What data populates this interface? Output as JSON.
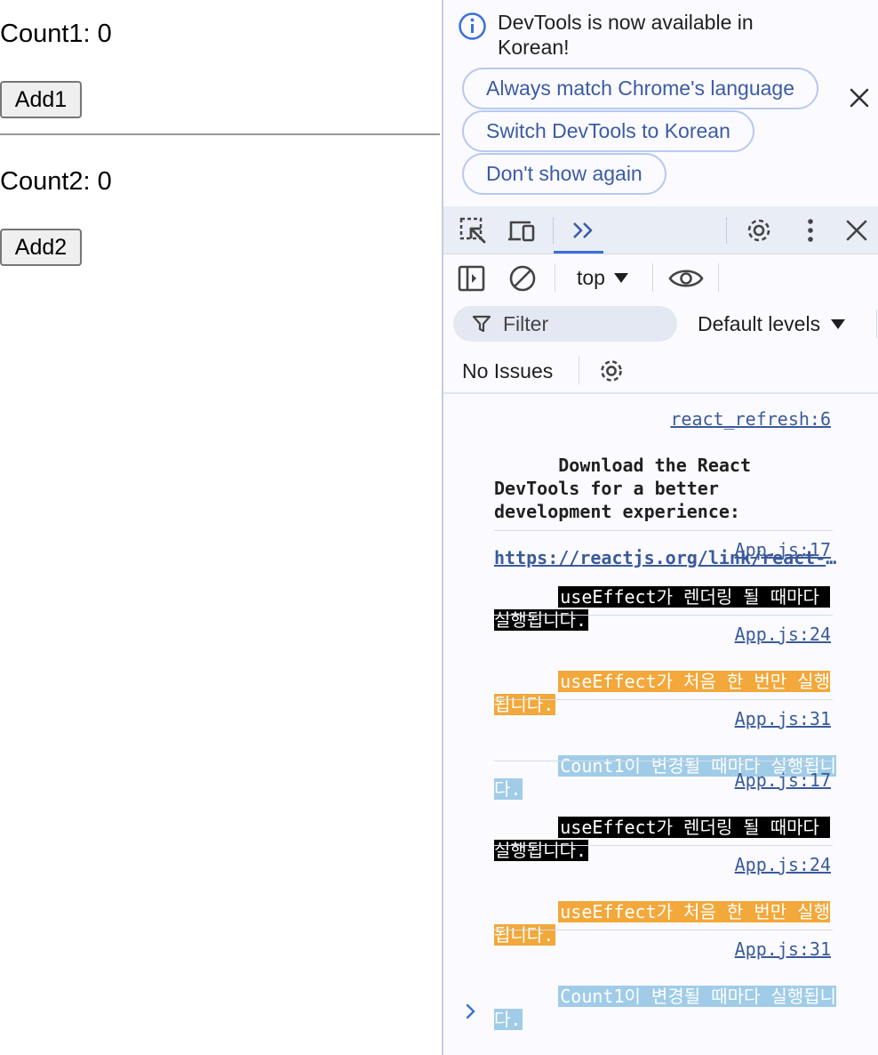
{
  "app": {
    "count1_text": "Count1: 0",
    "add1_label": "Add1",
    "count2_text": "Count2: 0",
    "add2_label": "Add2"
  },
  "devtools": {
    "infobar": {
      "icon": "info-icon",
      "message": "DevTools is now available in Korean!",
      "buttons": [
        {
          "label": "Always match Chrome's language"
        },
        {
          "label": "Switch DevTools to Korean"
        },
        {
          "label": "Don't show again"
        }
      ],
      "close_icon": "close-icon"
    },
    "toolbar": {
      "icons": [
        "inspect-element-icon",
        "device-toolbar-icon",
        "more-tabs-icon",
        "settings-icon",
        "kebab-menu-icon",
        "close-icon"
      ]
    },
    "console_toolbar": {
      "context": "top",
      "icons": [
        "sidebar-toggle-icon",
        "clear-console-icon",
        "eye-icon"
      ]
    },
    "filter": {
      "placeholder": "Filter",
      "levels": "Default levels"
    },
    "issues": {
      "text": "No Issues"
    },
    "log": [
      {
        "source": "react_refresh:6",
        "message": "Download the React DevTools for a better development experience: ",
        "link": "https://reactjs.org/link/react-devtools"
      },
      {
        "source": "App.js:17",
        "message": "useEffect가 렌더링 될 때마다 실행됩니다.",
        "bg": "#000000"
      },
      {
        "source": "App.js:24",
        "message": "useEffect가 처음 한 번만 실행됩니다.",
        "bg": "#f2a83a"
      },
      {
        "source": "App.js:31",
        "message": "Count1이 변경될 때마다 실행됩니다.",
        "bg": "#a0cce8"
      },
      {
        "source": "App.js:17",
        "message": "useEffect가 렌더링 될 때마다 실행됩니다.",
        "bg": "#000000"
      },
      {
        "source": "App.js:24",
        "message": "useEffect가 처음 한 번만 실행됩니다.",
        "bg": "#f2a83a"
      },
      {
        "source": "App.js:31",
        "message": "Count1이 변경될 때마다 실행됩니다.",
        "bg": "#a0cce8"
      }
    ],
    "colors": {
      "accent": "#3b6ed6",
      "link": "#3a5a9a",
      "pill_border": "#b8c9ef"
    }
  }
}
